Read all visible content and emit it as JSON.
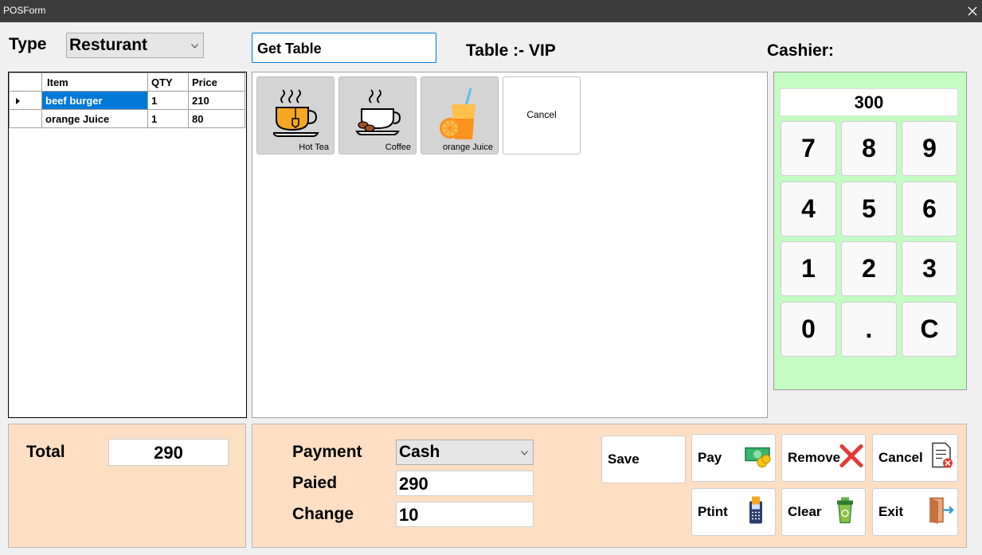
{
  "window": {
    "title": "POSForm",
    "close_glyph": "✕"
  },
  "type_label": "Type",
  "type_select": {
    "value": "Resturant"
  },
  "get_table_button": "Get Table",
  "table_label": "Table :- VIP",
  "cashier_label": "Cashier:",
  "order_grid": {
    "columns": [
      "Item",
      "QTY",
      "Price"
    ],
    "rows": [
      {
        "item": "beef burger",
        "qty": "1",
        "price": "210",
        "selected": true
      },
      {
        "item": "orange Juice",
        "qty": "1",
        "price": "80",
        "selected": false
      }
    ]
  },
  "menu_items": [
    {
      "label": "Hot Tea",
      "icon": "hot-tea-icon"
    },
    {
      "label": "Coffee",
      "icon": "coffee-icon"
    },
    {
      "label": "orange Juice",
      "icon": "orange-juice-icon"
    },
    {
      "label": "Cancel"
    }
  ],
  "numpad": {
    "display": "300",
    "keys": [
      "7",
      "8",
      "9",
      "4",
      "5",
      "6",
      "1",
      "2",
      "3",
      "0",
      ".",
      "C"
    ]
  },
  "total": {
    "label": "Total",
    "value": "290"
  },
  "payment": {
    "payment_label": "Payment",
    "payment_value": "Cash",
    "paid_label": "Paied",
    "paid_value": "290",
    "change_label": "Change",
    "change_value": "10"
  },
  "actions": {
    "save": "Save",
    "pay": "Pay",
    "remove": "Remove",
    "cancel": "Cancel",
    "print": "Ptint",
    "clear": "Clear",
    "exit": "Exit"
  },
  "colors": {
    "titlebar": "#3c3c3c",
    "numpad_bg": "#c4fcc4",
    "footer_bg": "#ffdfc4",
    "selection": "#0078d7"
  }
}
